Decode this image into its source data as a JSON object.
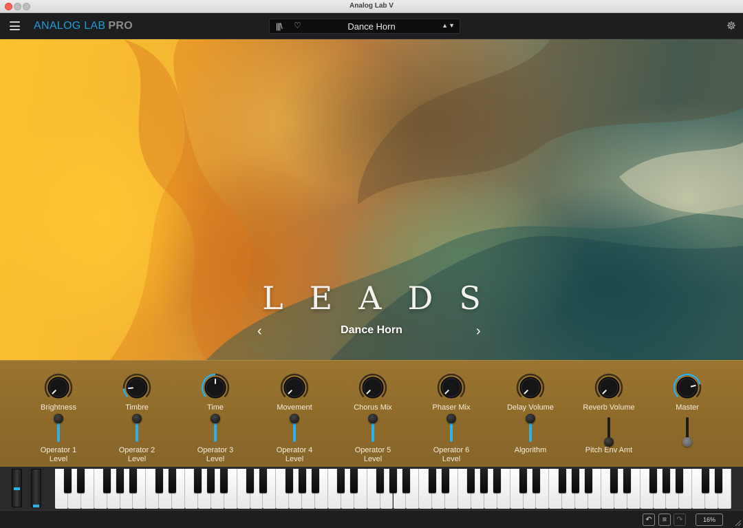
{
  "window": {
    "title": "Analog Lab V"
  },
  "header": {
    "brand_primary": "ANALOG LAB",
    "brand_secondary": "PRO",
    "preset_name": "Dance Horn",
    "preset_arrows": "▲▼"
  },
  "hero": {
    "category": "LEADS",
    "preset_name": "Dance Horn",
    "prev_icon": "‹",
    "next_icon": "›"
  },
  "knobs": [
    {
      "label": "Brightness",
      "value": 0.0
    },
    {
      "label": "Timbre",
      "value": 0.15
    },
    {
      "label": "Time",
      "value": 0.5
    },
    {
      "label": "Movement",
      "value": 0.0
    },
    {
      "label": "Chorus Mix",
      "value": 0.0
    },
    {
      "label": "Phaser Mix",
      "value": 0.0
    },
    {
      "label": "Delay Volume",
      "value": 0.0
    },
    {
      "label": "Reverb Volume",
      "value": 0.0
    },
    {
      "label": "Master",
      "value": 0.78
    }
  ],
  "faders": [
    {
      "label": "Operator 1\nLevel",
      "value": 0.95
    },
    {
      "label": "Operator 2\nLevel",
      "value": 0.95
    },
    {
      "label": "Operator 3\nLevel",
      "value": 0.95
    },
    {
      "label": "Operator 4\nLevel",
      "value": 0.95
    },
    {
      "label": "Operator 5\nLevel",
      "value": 0.95
    },
    {
      "label": "Operator 6\nLevel",
      "value": 0.95
    },
    {
      "label": "Algorithm",
      "value": 0.95
    },
    {
      "label": "Pitch Env Amt",
      "value": 0.0
    },
    {
      "label": "",
      "value": 0.0
    }
  ],
  "wheels": [
    {
      "name": "pitch",
      "value": 0.5
    },
    {
      "name": "mod",
      "value": 0.0
    }
  ],
  "status": {
    "undo_icon": "↶",
    "list_icon": "≡",
    "redo_icon": "↷",
    "cpu": "16%"
  },
  "colors": {
    "accent": "#2eb0e8",
    "panel": "#8e6a2a",
    "brand": "#1e9bd7"
  }
}
